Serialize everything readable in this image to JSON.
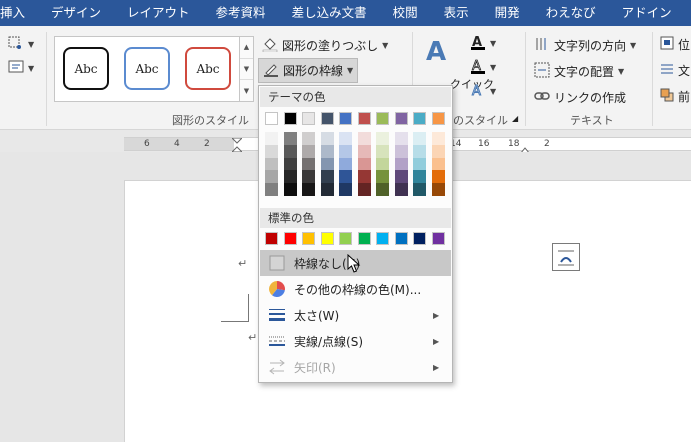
{
  "tabs": [
    "挿入",
    "デザイン",
    "レイアウト",
    "参考資料",
    "差し込み文書",
    "校閲",
    "表示",
    "開発",
    "わえなび",
    "アドイン"
  ],
  "ribbon": {
    "shape_styles_group": "図形のスタイル",
    "shape_fill": "図形の塗りつぶし",
    "shape_outline": "図形の枠線",
    "gallery_items": [
      "Abc",
      "Abc",
      "Abc"
    ],
    "wordart_label": "クイック",
    "wordart_group": "のスタイル",
    "text_direction": "文字列の方向",
    "text_align": "文字の配置",
    "create_link": "リンクの作成",
    "text_group": "テキスト",
    "position_partial": "位",
    "wrap_partial": "文",
    "front_partial": "前"
  },
  "ruler": {
    "numbers": [
      "6",
      "4",
      "2",
      "14",
      "16",
      "18",
      "2"
    ]
  },
  "menu": {
    "theme_colors_heading": "テーマの色",
    "standard_colors_heading": "標準の色",
    "theme_top_row": [
      "#ffffff",
      "#000000",
      "#e7e6e6",
      "#44546a",
      "#4472c4",
      "#c0504d",
      "#9bbb59",
      "#8064a2",
      "#4bacc6",
      "#f79646"
    ],
    "theme_shades": [
      [
        "#f2f2f2",
        "#d9d9d9",
        "#bfbfbf",
        "#a6a6a6",
        "#7f7f7f"
      ],
      [
        "#7f7f7f",
        "#595959",
        "#3f3f3f",
        "#262626",
        "#0d0d0d"
      ],
      [
        "#d0cece",
        "#aeaaaa",
        "#757171",
        "#3a3838",
        "#171616"
      ],
      [
        "#d6dce4",
        "#adb9ca",
        "#8496b0",
        "#323f4f",
        "#222a35"
      ],
      [
        "#dae3f3",
        "#b4c7e7",
        "#8faadc",
        "#2f5597",
        "#1f3864"
      ],
      [
        "#f2dcdb",
        "#e6b9b8",
        "#d99694",
        "#953734",
        "#632423"
      ],
      [
        "#ebf1de",
        "#d7e3bc",
        "#c3d69b",
        "#76923c",
        "#4f6128"
      ],
      [
        "#e5e0ec",
        "#ccc1d9",
        "#b2a1c7",
        "#5f497a",
        "#3f3151"
      ],
      [
        "#dbeef3",
        "#b7dde8",
        "#92cddc",
        "#31859b",
        "#205867"
      ],
      [
        "#fde9d9",
        "#fbd5b5",
        "#fac08f",
        "#e36c09",
        "#974806"
      ]
    ],
    "standard_colors": [
      "#c00000",
      "#ff0000",
      "#ffc000",
      "#ffff00",
      "#92d050",
      "#00b050",
      "#00b0f0",
      "#0070c0",
      "#002060",
      "#7030a0"
    ],
    "items": [
      {
        "label": "枠線なし(N)",
        "icon": "no-outline-icon",
        "highlighted": true,
        "disabled": false,
        "submenu": false
      },
      {
        "label": "その他の枠線の色(M)...",
        "icon": "color-wheel-icon",
        "highlighted": false,
        "disabled": false,
        "submenu": false
      },
      {
        "label": "太さ(W)",
        "icon": "line-weight-icon",
        "highlighted": false,
        "disabled": false,
        "submenu": true
      },
      {
        "label": "実線/点線(S)",
        "icon": "dashes-icon",
        "highlighted": false,
        "disabled": false,
        "submenu": true
      },
      {
        "label": "矢印(R)",
        "icon": "arrows-icon",
        "highlighted": false,
        "disabled": true,
        "submenu": true
      }
    ]
  },
  "document": {
    "paragraph_mark": "↵"
  }
}
